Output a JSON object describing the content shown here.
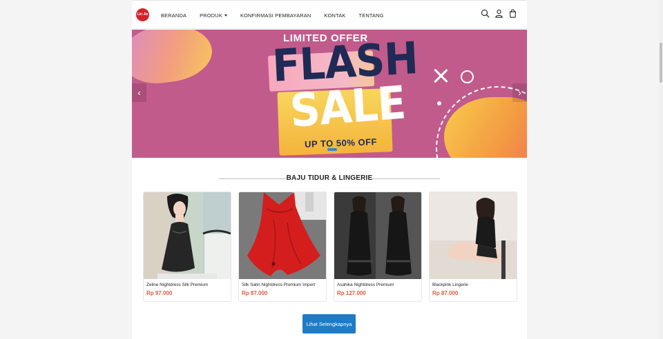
{
  "header": {
    "logo_text": "Lin Jie",
    "nav": [
      {
        "label": "BERANDA"
      },
      {
        "label": "PRODUK",
        "has_caret": true
      },
      {
        "label": "KONFIRMASI PEMBAYARAN"
      },
      {
        "label": "KONTAK"
      },
      {
        "label": "TENTANG"
      }
    ],
    "icons": [
      "search-icon",
      "user-icon",
      "shopping-bag-icon"
    ]
  },
  "banner": {
    "headline_top": "LIMITED OFFER",
    "headline_a": "FLASH",
    "headline_b": "SALE",
    "subline": "UP TO 50% OFF",
    "prev_icon": "‹",
    "next_icon": "›",
    "colors": {
      "background": "#c15b8b",
      "navy": "#1f2a55",
      "indicator": "#3a86c8"
    }
  },
  "section": {
    "title": "BAJU TIDUR & LINGERIE"
  },
  "products": [
    {
      "name": "Zeline Nightdress Silk Premium",
      "price": "Rp 97.000"
    },
    {
      "name": "Silk Satin Nightdress Premium Import",
      "price": "Rp 87.000"
    },
    {
      "name": "Asahika Nightdress Premium",
      "price": "Rp 127.000"
    },
    {
      "name": "Blackpink Lingerie",
      "price": "Rp 87.000"
    }
  ],
  "more_button": "Lihat Selengkapnya",
  "colors": {
    "price": "#e05a3b",
    "button": "#1e7cc6",
    "logo": "#d6222a"
  }
}
